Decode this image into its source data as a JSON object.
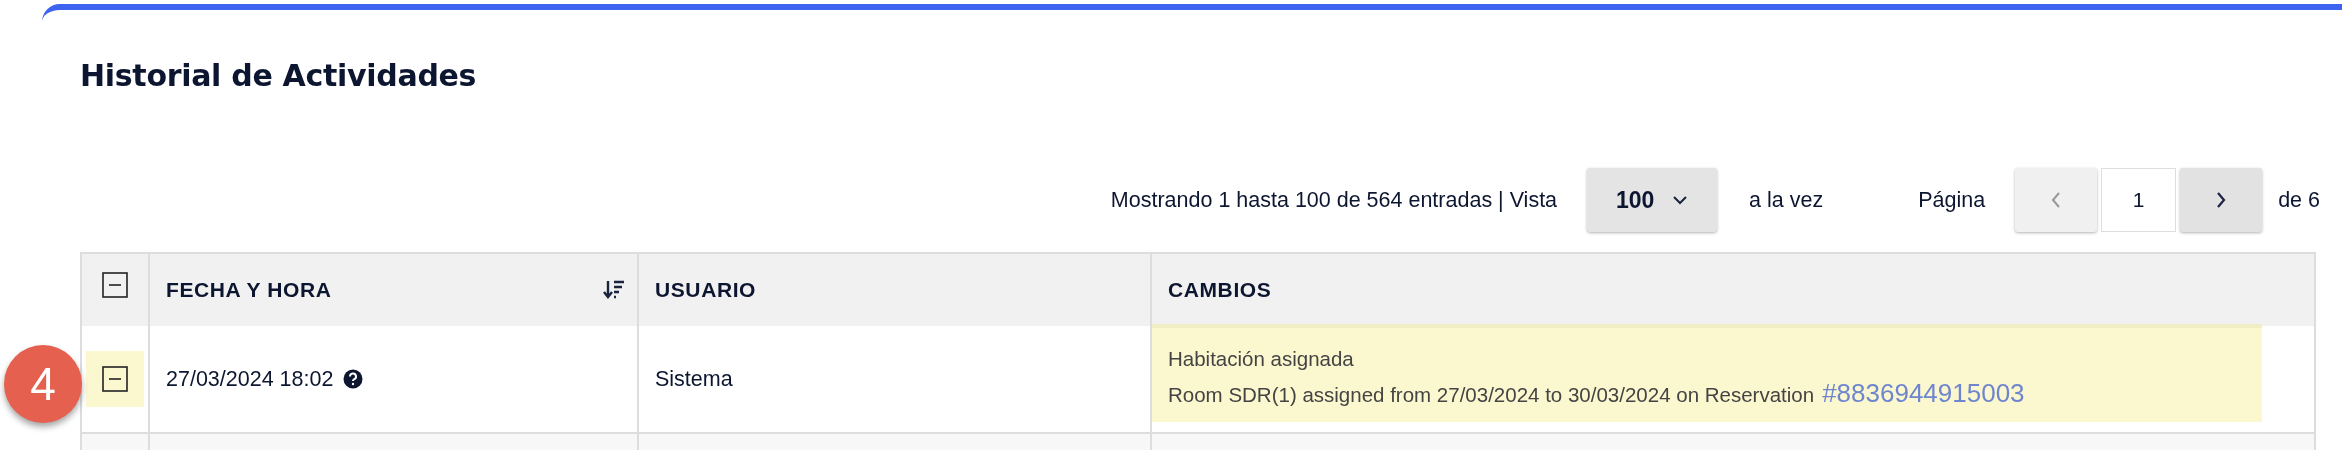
{
  "title": "Historial de Actividades",
  "pagination": {
    "summary": "Mostrando 1 hasta 100 de 564 entradas | Vista",
    "per_page": "100",
    "per_page_suffix": "a la vez",
    "page_label": "Página",
    "page": "1",
    "page_total": "de 6"
  },
  "table": {
    "expanded": true,
    "columns": [
      {
        "label": "FECHA Y HORA",
        "sortable": true
      },
      {
        "label": "USUARIO",
        "sortable": false
      },
      {
        "label": "CAMBIOS",
        "sortable": false
      }
    ],
    "rows": [
      {
        "expanded": true,
        "highlighted": true,
        "date": "27/03/2024 18:02",
        "user": "Sistema",
        "change_title": "Habitación asignada",
        "change_detail": "Room SDR(1) assigned from 27/03/2024 to 30/03/2024 on Reservation",
        "link": "#8836944915003"
      }
    ]
  },
  "step_badge": "4"
}
